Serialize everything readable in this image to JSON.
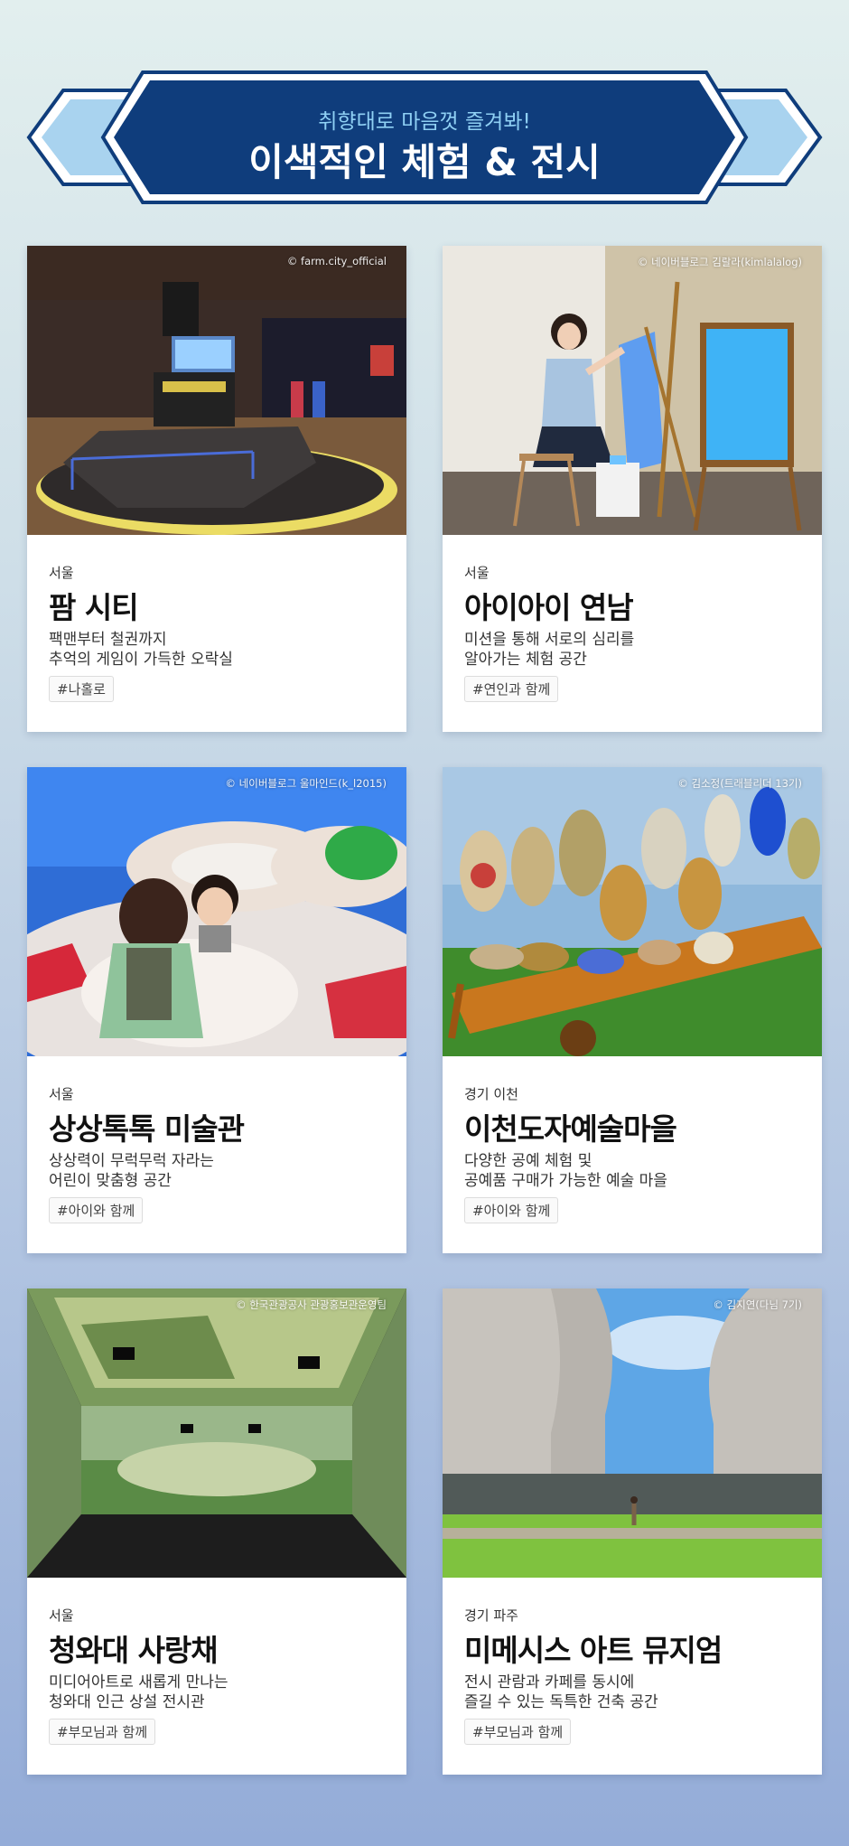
{
  "banner": {
    "subtitle": "취향대로 마음껏 즐겨봐!",
    "title": "이색적인 체험 & 전시"
  },
  "colors": {
    "banner_navy": "#0f3d7c",
    "banner_light": "#a9d3ef",
    "subtitle": "#8fd0f4"
  },
  "cards": [
    {
      "credit": "© farm.city_official",
      "region": "서울",
      "title": "팜 시티",
      "desc": [
        "팩맨부터 철권까지",
        "추억의 게임이 가득한 오락실"
      ],
      "tag": "#나홀로",
      "photo": "arcade-game-room-photo"
    },
    {
      "credit": "© 네이버블로그 김랄라(kimlalalog)",
      "region": "서울",
      "title": "아이아이 연남",
      "desc": [
        "미션을 통해 서로의 심리를",
        "알아가는 체험 공간"
      ],
      "tag": "#연인과 함께",
      "photo": "woman-painting-easel-photo"
    },
    {
      "credit": "© 네이버블로그 울마인드(k_l2015)",
      "region": "서울",
      "title": "상상톡톡 미술관",
      "desc": [
        "상상력이 무럭무럭 자라는",
        "어린이 맞춤형 공간"
      ],
      "tag": "#아이와 함께",
      "photo": "children-play-room-photo"
    },
    {
      "credit": "© 김소정(트래블리더 13기)",
      "region": "경기 이천",
      "title": "이천도자예술마을",
      "desc": [
        "다양한 공예 체험 및",
        "공예품 구매가 가능한 예술 마을"
      ],
      "tag": "#아이와 함께",
      "photo": "ceramics-cart-photo"
    },
    {
      "credit": "© 한국관광공사 관광홍보관운영팀",
      "region": "서울",
      "title": "청와대 사랑채",
      "desc": [
        "미디어아트로 새롭게 만나는",
        "청와대 인근 상설 전시관"
      ],
      "tag": "#부모님과 함께",
      "photo": "media-art-hall-photo"
    },
    {
      "credit": "© 김지연(다님 7기)",
      "region": "경기 파주",
      "title": "미메시스 아트 뮤지엄",
      "desc": [
        "전시 관람과 카페를 동시에",
        "즐길 수 있는 독특한 건축 공간"
      ],
      "tag": "#부모님과 함께",
      "photo": "museum-architecture-photo"
    }
  ]
}
